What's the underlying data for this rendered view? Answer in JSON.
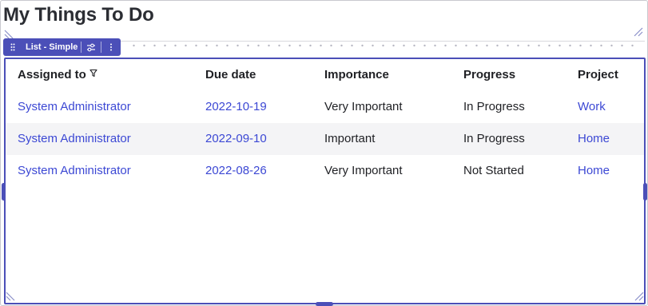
{
  "page": {
    "title": "My Things To Do"
  },
  "toolbar": {
    "label": "List - Simple",
    "drag_icon": "drag-dots-icon",
    "settings_icon": "sliders-icon",
    "more_icon": "more-vertical-icon"
  },
  "table": {
    "columns": [
      {
        "label": "Assigned to",
        "filterable": true
      },
      {
        "label": "Due date"
      },
      {
        "label": "Importance"
      },
      {
        "label": "Progress"
      },
      {
        "label": "Project"
      }
    ],
    "rows": [
      {
        "assigned_to": "System Administrator",
        "due_date": "2022-10-19",
        "importance": "Very Important",
        "progress": "In Progress",
        "project": "Work"
      },
      {
        "assigned_to": "System Administrator",
        "due_date": "2022-09-10",
        "importance": "Important",
        "progress": "In Progress",
        "project": "Home"
      },
      {
        "assigned_to": "System Administrator",
        "due_date": "2022-08-26",
        "importance": "Very Important",
        "progress": "Not Started",
        "project": "Home"
      }
    ]
  },
  "colors": {
    "accent": "#4b4fb8",
    "link": "#3c48d4",
    "text": "#1f2024",
    "row_alt": "#f4f4f6"
  }
}
